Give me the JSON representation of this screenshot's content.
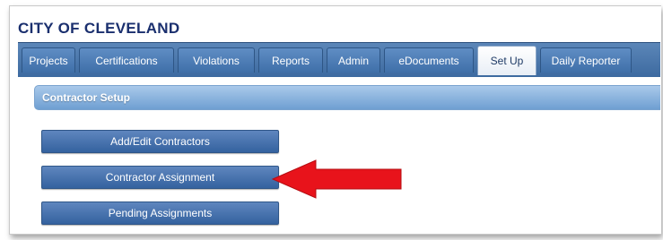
{
  "header": {
    "city_title": "CITY OF CLEVELAND"
  },
  "tabs": [
    {
      "label": "Projects"
    },
    {
      "label": "Certifications"
    },
    {
      "label": "Violations"
    },
    {
      "label": "Reports"
    },
    {
      "label": "Admin"
    },
    {
      "label": "eDocuments"
    },
    {
      "label": "Set Up",
      "active": true
    },
    {
      "label": "Daily Reporter"
    }
  ],
  "section": {
    "title": "Contractor Setup"
  },
  "buttons": [
    {
      "label": "Add/Edit Contractors"
    },
    {
      "label": "Contractor Assignment"
    },
    {
      "label": "Pending Assignments"
    }
  ],
  "colors": {
    "tab_bar": "#4a78ae",
    "section_header": "#8db6e0",
    "button": "#4a74ae",
    "annotation_arrow": "#e8131b"
  }
}
